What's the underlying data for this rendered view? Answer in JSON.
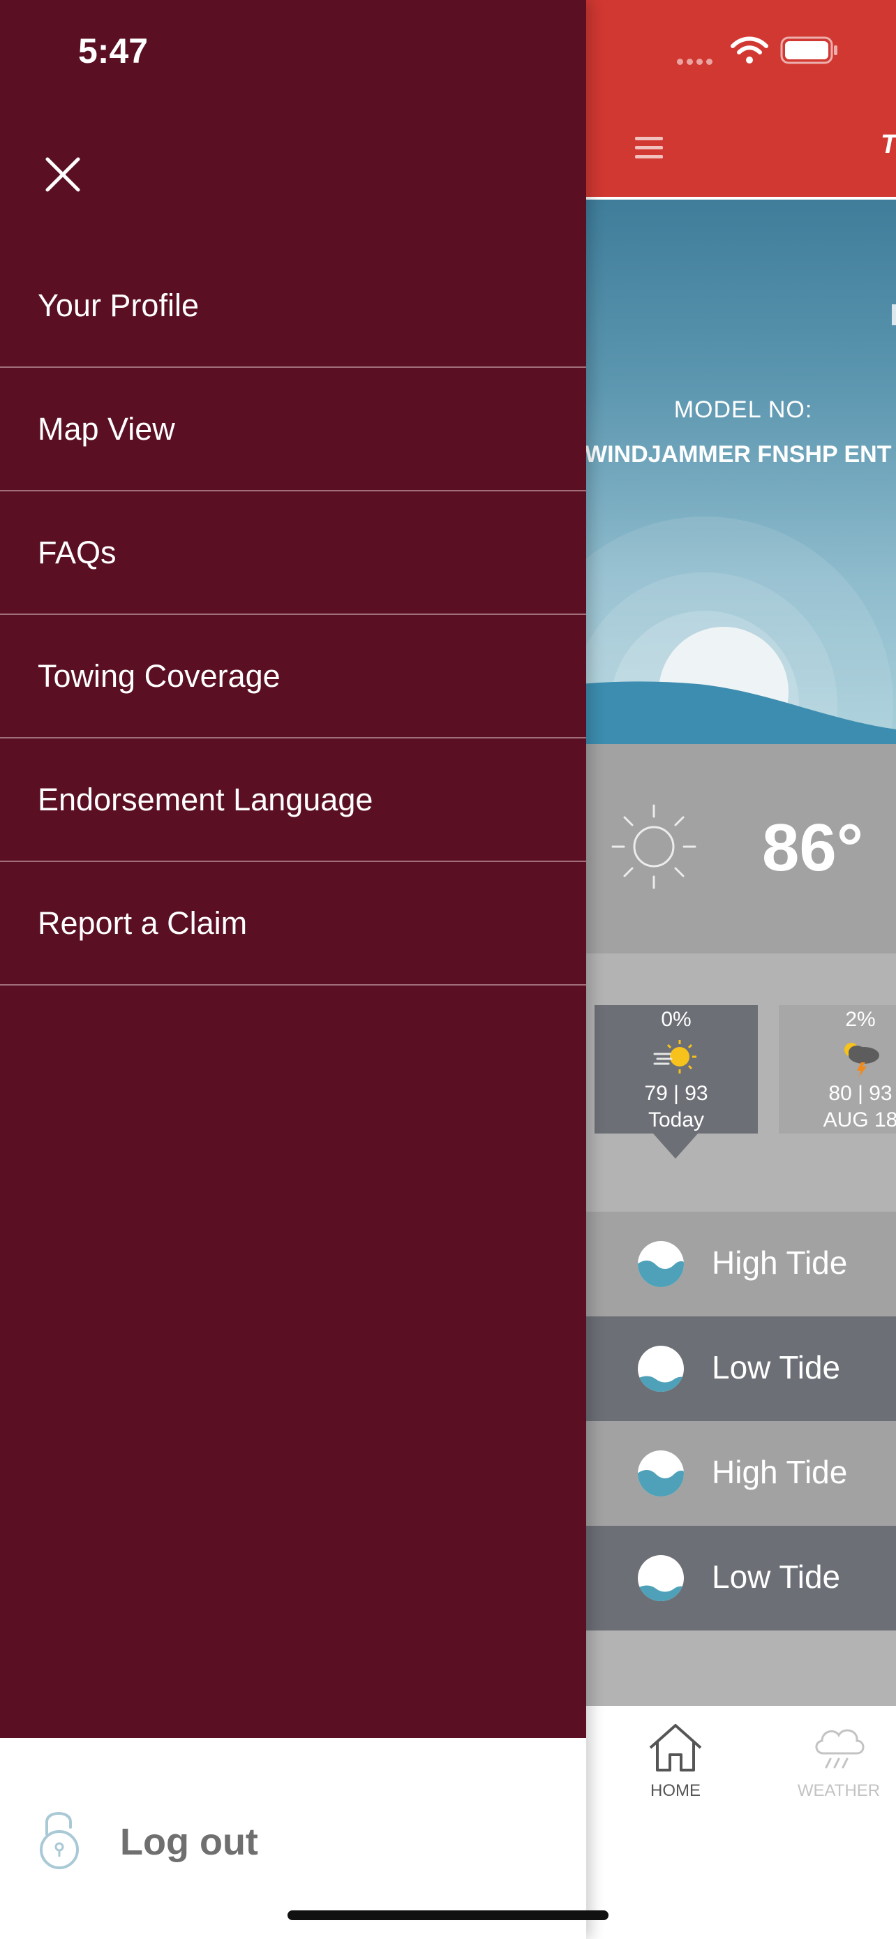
{
  "status_bar": {
    "time": "5:47",
    "icons": [
      "cellular-dots-icon",
      "wifi-icon",
      "battery-icon"
    ]
  },
  "app_header": {
    "menu_icon": "hamburger-icon",
    "title_partial": "T",
    "background_color": "#d13832"
  },
  "hero": {
    "model_label": "MODEL NO:",
    "model_name": "WINDJAMMER FNSHP ENT"
  },
  "current_weather": {
    "icon": "sun-outline-icon",
    "temperature": "86°"
  },
  "forecast": [
    {
      "precip": "0%",
      "icon": "sunny-windy-icon",
      "temps": "79  |  93",
      "day": "Today",
      "selected": true
    },
    {
      "precip": "2%",
      "icon": "thunderstorm-icon",
      "temps": "80  |  93",
      "day": "AUG 18",
      "selected": false
    }
  ],
  "tides": [
    {
      "label": "High Tide",
      "icon": "tide-icon"
    },
    {
      "label": "Low Tide",
      "icon": "tide-icon"
    },
    {
      "label": "High Tide",
      "icon": "tide-icon"
    },
    {
      "label": "Low Tide",
      "icon": "tide-icon"
    }
  ],
  "tab_bar": [
    {
      "label": "HOME",
      "icon": "home-icon",
      "active": true
    },
    {
      "label": "WEATHER",
      "icon": "weather-cloud-icon",
      "active": false
    }
  ],
  "drawer": {
    "background_color": "#5a0f23",
    "close_icon": "close-icon",
    "menu_items": [
      {
        "label": "Your Profile"
      },
      {
        "label": "Map View"
      },
      {
        "label": "FAQs"
      },
      {
        "label": "Towing Coverage"
      },
      {
        "label": "Endorsement Language"
      },
      {
        "label": "Report a Claim"
      }
    ],
    "logout": {
      "label": "Log out",
      "icon": "lock-icon"
    }
  }
}
